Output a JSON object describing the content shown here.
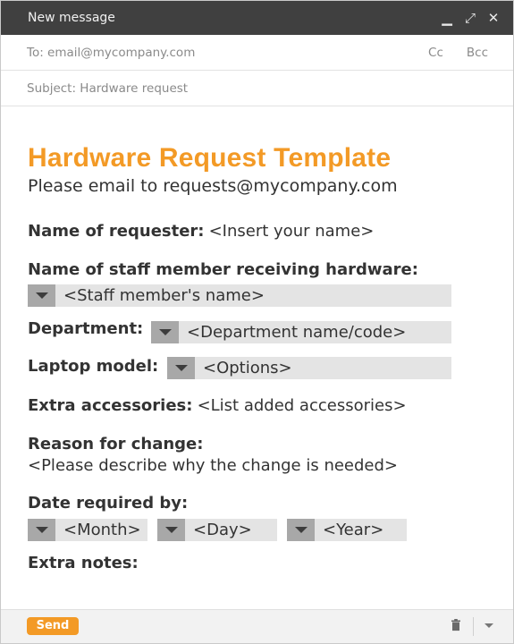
{
  "window": {
    "title": "New message",
    "minimize_icon": "minimize-icon",
    "expand_icon": "expand-icon",
    "close_icon": "close-icon"
  },
  "fields": {
    "to": "To: email@mycompany.com",
    "cc": "Cc",
    "bcc": "Bcc",
    "subject": "Subject: Hardware request"
  },
  "template": {
    "title": "Hardware Request Template",
    "instructions": "Please email to requests@mycompany.com",
    "requester_label": "Name of requester:",
    "requester_value": "<Insert your name>",
    "staff_label": "Name of staff member receiving hardware:",
    "staff_select": "<Staff member's name>",
    "department_label": "Department:",
    "department_select": "<Department name/code>",
    "laptop_label": "Laptop model:",
    "laptop_select": "<Options>",
    "accessories_label": "Extra accessories:",
    "accessories_value": "<List added accessories>",
    "reason_label": "Reason for change:",
    "reason_value": "<Please describe why the change is needed>",
    "date_label": "Date required by:",
    "month_select": "<Month>",
    "day_select": "<Day>",
    "year_select": "<Year>",
    "notes_label": "Extra notes:"
  },
  "footer": {
    "send_label": "Send",
    "trash_icon": "trash-icon",
    "more_icon": "chevron-down-icon"
  },
  "colors": {
    "accent": "#f39a26",
    "titlebar": "#404040",
    "select_bg": "#e4e4e4",
    "select_button": "#a8a8a8"
  }
}
